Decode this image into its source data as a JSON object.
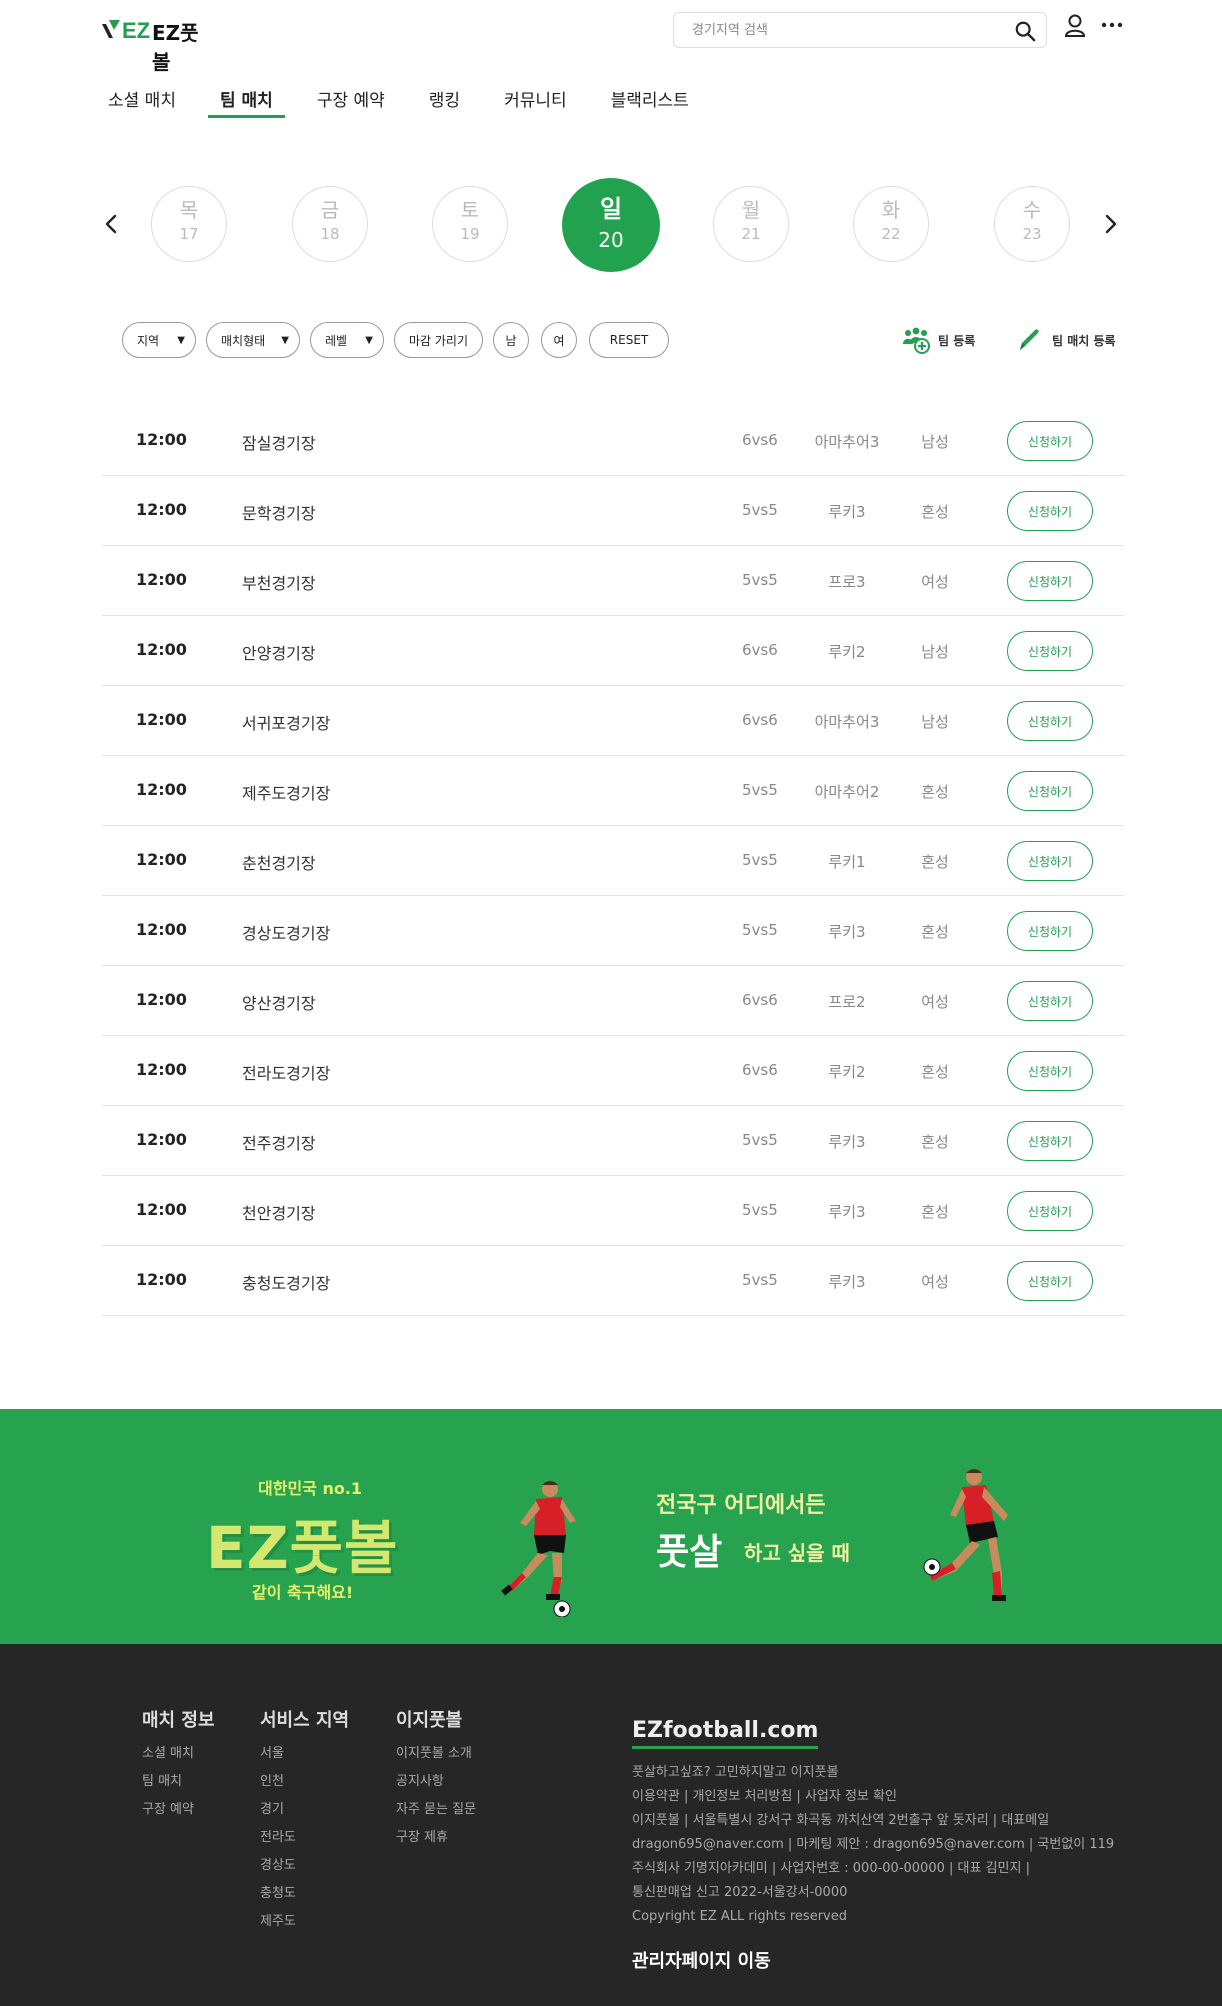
{
  "header": {
    "logo_text": "EZ풋볼",
    "search_placeholder": "경기지역 검색"
  },
  "nav": {
    "tabs": [
      {
        "label": "소셜 매치",
        "active": false
      },
      {
        "label": "팀 매치",
        "active": true
      },
      {
        "label": "구장 예약",
        "active": false
      },
      {
        "label": "랭킹",
        "active": false
      },
      {
        "label": "커뮤니티",
        "active": false
      },
      {
        "label": "블랙리스트",
        "active": false
      }
    ]
  },
  "dates": [
    {
      "weekday": "목",
      "day": "17",
      "active": false
    },
    {
      "weekday": "금",
      "day": "18",
      "active": false
    },
    {
      "weekday": "토",
      "day": "19",
      "active": false
    },
    {
      "weekday": "일",
      "day": "20",
      "active": true
    },
    {
      "weekday": "월",
      "day": "21",
      "active": false
    },
    {
      "weekday": "화",
      "day": "22",
      "active": false
    },
    {
      "weekday": "수",
      "day": "23",
      "active": false
    }
  ],
  "filters": {
    "region": "지역",
    "match_type": "매치형태",
    "level": "레벨",
    "hide_closed": "마감 가리기",
    "male": "남",
    "female": "여",
    "reset": "RESET"
  },
  "actions": {
    "team_register": "팀 등록",
    "team_match_register": "팀 매치 등록"
  },
  "matches": [
    {
      "time": "12:00",
      "stadium": "잠실경기장",
      "type": "6vs6",
      "level": "아마추어3",
      "gender": "남성",
      "button": "신청하기"
    },
    {
      "time": "12:00",
      "stadium": "문학경기장",
      "type": "5vs5",
      "level": "루키3",
      "gender": "혼성",
      "button": "신청하기"
    },
    {
      "time": "12:00",
      "stadium": "부천경기장",
      "type": "5vs5",
      "level": "프로3",
      "gender": "여성",
      "button": "신청하기"
    },
    {
      "time": "12:00",
      "stadium": "안양경기장",
      "type": "6vs6",
      "level": "루키2",
      "gender": "남성",
      "button": "신청하기"
    },
    {
      "time": "12:00",
      "stadium": "서귀포경기장",
      "type": "6vs6",
      "level": "아마추어3",
      "gender": "남성",
      "button": "신청하기"
    },
    {
      "time": "12:00",
      "stadium": "제주도경기장",
      "type": "5vs5",
      "level": "아마추어2",
      "gender": "혼성",
      "button": "신청하기"
    },
    {
      "time": "12:00",
      "stadium": "춘천경기장",
      "type": "5vs5",
      "level": "루키1",
      "gender": "혼성",
      "button": "신청하기"
    },
    {
      "time": "12:00",
      "stadium": "경상도경기장",
      "type": "5vs5",
      "level": "루키3",
      "gender": "혼성",
      "button": "신청하기"
    },
    {
      "time": "12:00",
      "stadium": "양산경기장",
      "type": "6vs6",
      "level": "프로2",
      "gender": "여성",
      "button": "신청하기"
    },
    {
      "time": "12:00",
      "stadium": "전라도경기장",
      "type": "6vs6",
      "level": "루키2",
      "gender": "혼성",
      "button": "신청하기"
    },
    {
      "time": "12:00",
      "stadium": "전주경기장",
      "type": "5vs5",
      "level": "루키3",
      "gender": "혼성",
      "button": "신청하기"
    },
    {
      "time": "12:00",
      "stadium": "천안경기장",
      "type": "5vs5",
      "level": "루키3",
      "gender": "혼성",
      "button": "신청하기"
    },
    {
      "time": "12:00",
      "stadium": "충청도경기장",
      "type": "5vs5",
      "level": "루키3",
      "gender": "여성",
      "button": "신청하기"
    }
  ],
  "banner": {
    "left_sub": "대한민국 no.1",
    "left_title": "EZ풋볼",
    "left_tagline": "같이 축구해요!",
    "right_line1": "전국구 어디에서든",
    "right_big": "풋살",
    "right_line2": "하고 싶을 때"
  },
  "footer": {
    "columns": [
      {
        "title": "매치 정보",
        "links": [
          "소셜 매치",
          "팀 매치",
          "구장 예약"
        ]
      },
      {
        "title": "서비스 지역",
        "links": [
          "서울",
          "인천",
          "경기",
          "전라도",
          "경상도",
          "충청도",
          "제주도"
        ]
      },
      {
        "title": "이지풋볼",
        "links": [
          "이지풋볼 소개",
          "공지사항",
          "자주 묻는 질문",
          "구장 제휴"
        ]
      }
    ],
    "brand": "EZfootball.com",
    "info_lines": [
      "풋살하고싶죠? 고민하지말고 이지풋볼",
      "이용약관 | 개인정보 처리방침 | 사업자 정보 확인",
      "이지풋볼 | 서울특별시 강서구 화곡동 까치산역 2번출구 앞 돗자리 | 대표메일",
      "dragon695@naver.com | 마케팅 제안 : dragon695@naver.com | 국번없이 119",
      "주식회사 기명지아카데미 | 사업자번호 : 000-00-00000 | 대표 김민지 |",
      "통신판매업 신고 2022-서울강서-0000",
      "Copyright EZ ALL rights reserved"
    ],
    "admin_link": "관리자페이지 이동"
  },
  "colors": {
    "accent": "#22a051",
    "banner": "#27a34f",
    "footer_bg": "#262626"
  }
}
